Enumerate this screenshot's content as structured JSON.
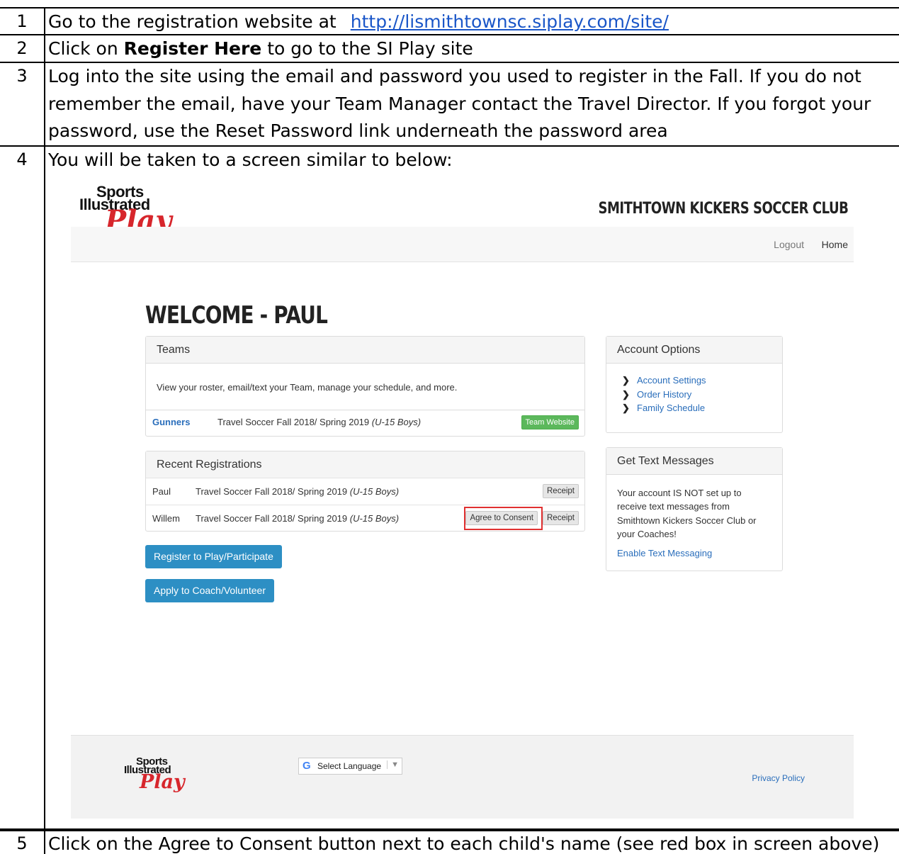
{
  "steps": [
    {
      "num": "1",
      "text": "Go to the registration website at",
      "link": "http://lismithtownsc.siplay.com/site/ "
    },
    {
      "num": "2",
      "prefix": "Click on ",
      "bold": "Register Here",
      "suffix": " to go to the SI Play site"
    },
    {
      "num": "3",
      "lines": [
        "Log into the site using the email and password you used to register in the Fall.  If you do not",
        "remember the email, have your Team Manager contact the Travel Director.  If you forgot your",
        "password, use the Reset Password link underneath the password area"
      ]
    },
    {
      "num": "4",
      "text": "You will be taken to a screen similar to below:"
    },
    {
      "num": "5",
      "text": "Click on the Agree to Consent button next to each child's name (see red box in screen above)"
    }
  ],
  "screenshot": {
    "logo": {
      "line1": "Sports",
      "line2": "Illustrated",
      "line3": "Play"
    },
    "club_title": "SMITHTOWN KICKERS SOCCER CLUB",
    "nav": {
      "logout": "Logout",
      "home": "Home"
    },
    "welcome": "WELCOME - PAUL",
    "teams": {
      "title": "Teams",
      "description": "View your roster, email/text your Team, manage your schedule, and more.",
      "team_name": "Gunners",
      "team_desc": "Travel Soccer Fall 2018/ Spring 2019",
      "team_div": "(U-15 Boys)",
      "website_button": "Team Website"
    },
    "recent": {
      "title": "Recent Registrations",
      "rows": [
        {
          "name": "Paul",
          "desc": "Travel Soccer Fall 2018/ Spring 2019",
          "div": "(U-15 Boys)",
          "receipt": "Receipt"
        },
        {
          "name": "Willem",
          "desc": "Travel Soccer Fall 2018/ Spring 2019",
          "div": "(U-15 Boys)",
          "consent": "Agree to Consent",
          "receipt": "Receipt"
        }
      ]
    },
    "buttons": {
      "register": "Register to Play/Participate",
      "apply": "Apply to Coach/Volunteer"
    },
    "account": {
      "title": "Account Options",
      "items": [
        "Account Settings",
        "Order History",
        "Family Schedule"
      ]
    },
    "texts": {
      "title": "Get Text Messages",
      "body": "Your account IS NOT set up to receive text messages from Smithtown Kickers Soccer Club or your Coaches!",
      "link": "Enable Text Messaging"
    },
    "footer": {
      "language": "Select Language",
      "google_glyph": "G",
      "privacy": "Privacy Policy"
    },
    "colors": {
      "link": "#2a6ebb",
      "green": "#5cb85c",
      "blue": "#2d8fc4",
      "highlight": "#e03030"
    }
  }
}
